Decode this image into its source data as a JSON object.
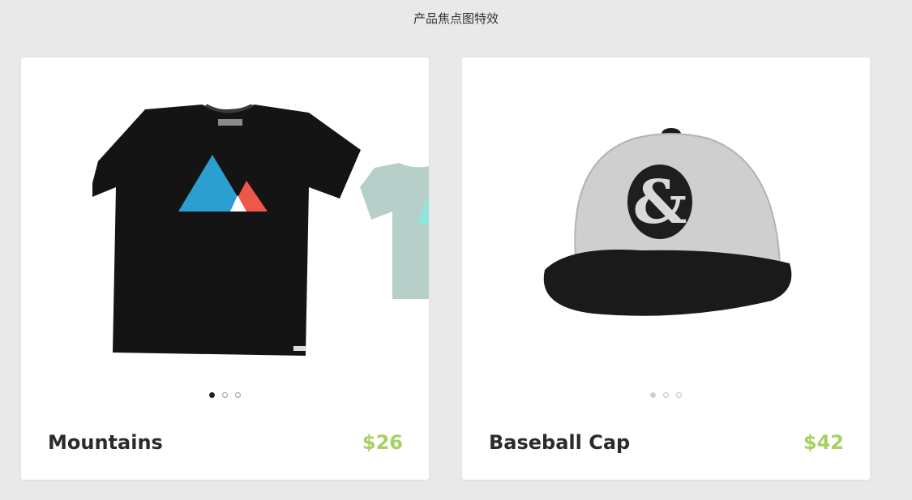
{
  "page": {
    "title": "产品焦点图特效"
  },
  "products": [
    {
      "name": "Mountains",
      "price": "$26",
      "image": "black-tshirt-mountain-print",
      "next_image": "mint-tshirt",
      "carousel": {
        "slides": 3,
        "active": 1
      }
    },
    {
      "name": "Baseball Cap",
      "price": "$42",
      "image": "grey-baseball-cap-ampersand",
      "carousel": {
        "slides": 3,
        "active": 1
      }
    }
  ],
  "colors": {
    "background": "#e9e9e9",
    "card": "#ffffff",
    "price": "#a6d160",
    "name": "#2b2a2e"
  }
}
